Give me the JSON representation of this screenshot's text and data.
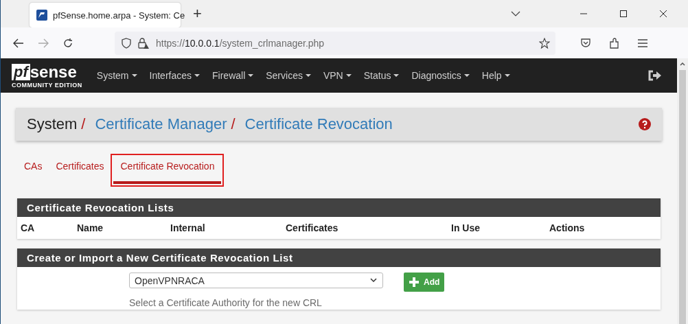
{
  "browser": {
    "tab_title": "pfSense.home.arpa - System: Ce",
    "new_tab": "+",
    "url_prefix": "https://",
    "url_host": "10.0.0.1",
    "url_path": "/system_crlmanager.php"
  },
  "navbar": {
    "logo": "sense",
    "logo_prefix": "pf",
    "edition": "COMMUNITY EDITION",
    "menus": [
      {
        "label": "System"
      },
      {
        "label": "Interfaces"
      },
      {
        "label": "Firewall"
      },
      {
        "label": "Services"
      },
      {
        "label": "VPN"
      },
      {
        "label": "Status"
      },
      {
        "label": "Diagnostics"
      },
      {
        "label": "Help"
      }
    ]
  },
  "breadcrumb_separator": "/",
  "breadcrumb": [
    {
      "label": "System",
      "link": false
    },
    {
      "label": "Certificate Manager",
      "link": true
    },
    {
      "label": "Certificate Revocation",
      "link": true
    }
  ],
  "tabs": [
    {
      "label": "CAs",
      "selected": false,
      "highlighted": false
    },
    {
      "label": "Certificates",
      "selected": false,
      "highlighted": false
    },
    {
      "label": "Certificate Revocation",
      "selected": true,
      "highlighted": true
    }
  ],
  "crl_panel": {
    "title": "Certificate Revocation Lists",
    "columns": [
      "CA",
      "Name",
      "Internal",
      "Certificates",
      "In Use",
      "Actions"
    ]
  },
  "create_panel": {
    "title": "Create or Import a New Certificate Revocation List",
    "select_value": "OpenVPNRACA",
    "help": "Select a Certificate Authority for the new CRL",
    "add_button": "Add"
  }
}
